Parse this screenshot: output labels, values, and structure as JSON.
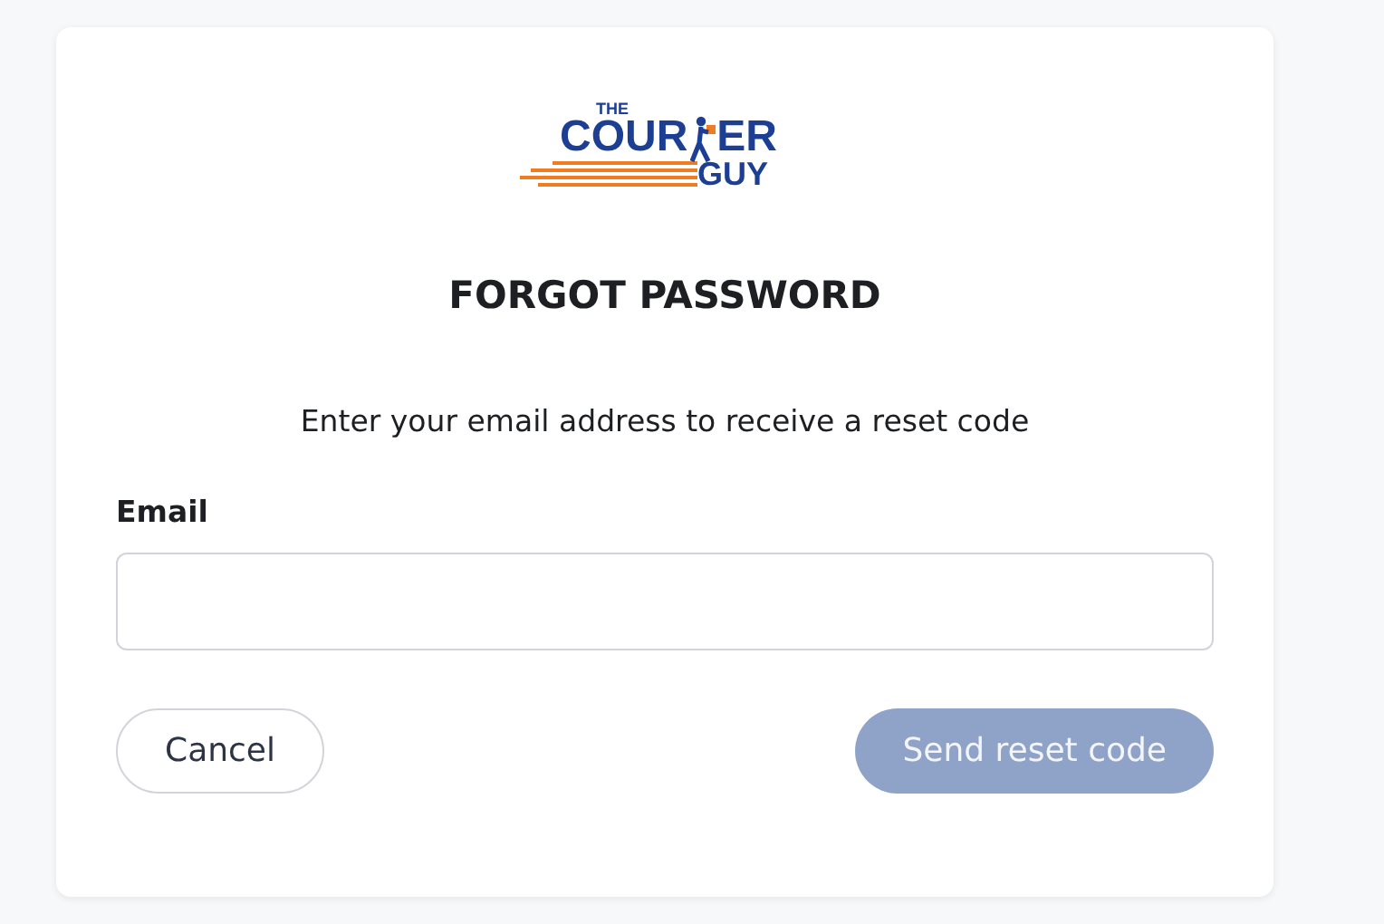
{
  "logo": {
    "top": "THE",
    "main_left": "COUR",
    "main_right": "ER",
    "bottom": "GUY"
  },
  "title": "FORGOT PASSWORD",
  "instructions": "Enter your email address to receive a reset code",
  "email_field": {
    "label": "Email"
  },
  "buttons": [
    {
      "label": "Cancel",
      "kind": "secondary",
      "disabled": false
    },
    {
      "label": "Send reset code",
      "kind": "primary",
      "disabled": true
    }
  ]
}
